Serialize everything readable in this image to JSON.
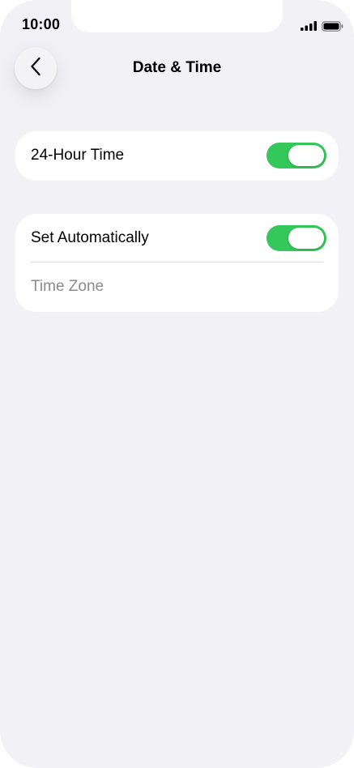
{
  "status_bar": {
    "time": "10:00",
    "signal_icon": "cellular-signal-icon",
    "battery_icon": "battery-icon"
  },
  "header": {
    "back_icon": "chevron-left-icon",
    "title": "Date & Time"
  },
  "settings": {
    "hour_24": {
      "label": "24-Hour Time",
      "enabled": true
    },
    "set_automatically": {
      "label": "Set Automatically",
      "enabled": true
    },
    "time_zone": {
      "label": "Time Zone"
    }
  },
  "colors": {
    "background": "#f1f1f6",
    "card": "#ffffff",
    "toggle_on": "#34c759",
    "muted_text": "#8a8a8e"
  }
}
